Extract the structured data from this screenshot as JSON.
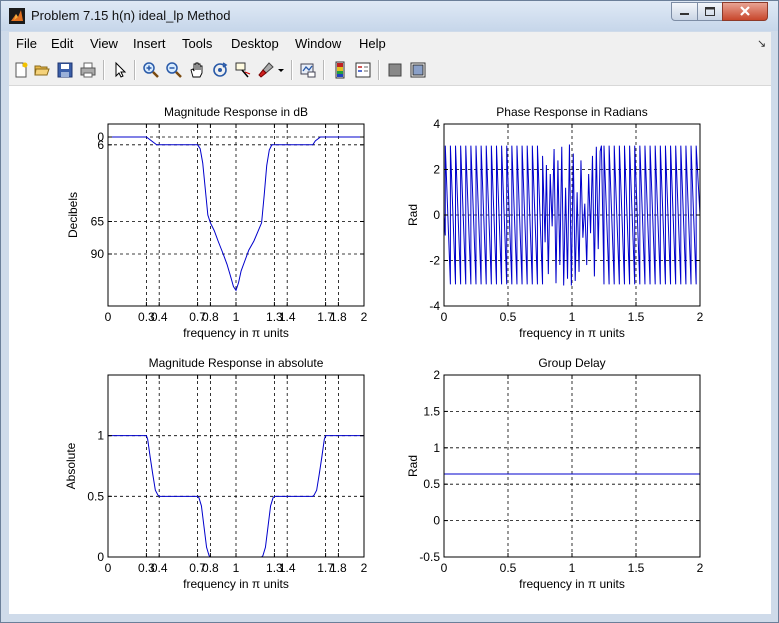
{
  "window": {
    "title": "Problem 7.15 h(n) ideal_lp Method"
  },
  "menubar": {
    "items": [
      "File",
      "Edit",
      "View",
      "Insert",
      "Tools",
      "Desktop",
      "Window",
      "Help"
    ]
  },
  "toolbar": {
    "icons": [
      "new-figure-icon",
      "open-file-icon",
      "save-icon",
      "print-icon",
      "edit-plot-icon",
      "zoom-in-icon",
      "zoom-out-icon",
      "pan-icon",
      "rotate-3d-icon",
      "data-cursor-icon",
      "brush-icon",
      "link-plot-icon",
      "colorbar-icon",
      "legend-icon",
      "hide-plot-tools-icon",
      "show-plot-tools-icon"
    ]
  },
  "colors": {
    "line": "#0000cc",
    "grid": "#000000",
    "figure_bg": "#ffffff"
  },
  "chart_data": [
    {
      "type": "line",
      "title": "Magnitude Response in dB",
      "xlabel": "frequency in π units",
      "ylabel": "Decibels",
      "xlim": [
        0,
        2
      ],
      "ylim": [
        -130,
        10
      ],
      "xticks": [
        0,
        0.3,
        0.4,
        0.7,
        0.8,
        1,
        1.3,
        1.4,
        1.7,
        1.8,
        2
      ],
      "xticklabels": [
        "0",
        "0.3",
        "0.4",
        "0.7",
        "0.8",
        "1",
        "1.3",
        "1.4",
        "1.7",
        "1.8",
        "2"
      ],
      "yticks": [
        0,
        -6,
        -65,
        -90
      ],
      "yticklabels": [
        "0",
        "6",
        "65",
        "90"
      ],
      "grid": true,
      "series": [
        {
          "x": [
            0,
            0.3,
            0.34,
            0.38,
            0.4,
            0.7,
            0.72,
            0.74,
            0.76,
            0.78,
            0.8,
            0.83,
            0.86,
            0.9,
            0.93,
            0.96,
            0.98,
            1.0,
            1.02,
            1.04,
            1.07,
            1.1,
            1.14,
            1.17,
            1.2,
            1.22,
            1.24,
            1.26,
            1.28,
            1.3,
            1.6,
            1.62,
            1.66,
            1.7,
            2.0
          ],
          "y": [
            0,
            0,
            -3,
            -6,
            -6,
            -6,
            -9,
            -20,
            -40,
            -60,
            -66,
            -72,
            -80,
            -90,
            -98,
            -108,
            -115,
            -118,
            -112,
            -103,
            -95,
            -87,
            -80,
            -73,
            -66,
            -45,
            -22,
            -10,
            -6,
            -6,
            -6,
            -3,
            0,
            0,
            0
          ]
        }
      ]
    },
    {
      "type": "line",
      "title": "Phase Response in Radians",
      "xlabel": "frequency in π units",
      "ylabel": "Rad",
      "xlim": [
        0,
        2
      ],
      "ylim": [
        -4,
        4
      ],
      "xticks": [
        0,
        0.5,
        1,
        1.5,
        2
      ],
      "xticklabels": [
        "0",
        "0.5",
        "1",
        "1.5",
        "2"
      ],
      "yticks": [
        -4,
        -2,
        0,
        2,
        4
      ],
      "yticklabels": [
        "-4",
        "-2",
        "0",
        "2",
        "4"
      ],
      "grid": true,
      "series": [
        {
          "x": [
            0,
            0.0099,
            0.01,
            0.0499,
            0.05,
            0.0899,
            0.09,
            0.1299,
            0.13,
            0.1699,
            0.17,
            0.2099,
            0.21,
            0.2499,
            0.25,
            0.2899,
            0.29,
            0.3299,
            0.33,
            0.3699,
            0.37,
            0.4099,
            0.41,
            0.4499,
            0.45,
            0.4899,
            0.49,
            0.5299,
            0.53,
            0.5699,
            0.57,
            0.6099,
            0.61,
            0.6499,
            0.65,
            0.6899,
            0.69,
            0.7299,
            0.73,
            0.7699,
            0.77,
            0.79,
            0.8,
            0.815,
            0.83,
            0.845,
            0.86,
            0.875,
            0.89,
            0.905,
            0.92,
            0.935,
            0.95,
            0.965,
            0.98,
            0.995,
            1.01,
            1.025,
            1.04,
            1.055,
            1.07,
            1.085,
            1.1,
            1.115,
            1.13,
            1.145,
            1.16,
            1.175,
            1.19,
            1.205,
            1.22,
            1.23,
            1.2499,
            1.25,
            1.2899,
            1.29,
            1.3299,
            1.33,
            1.3699,
            1.37,
            1.4099,
            1.41,
            1.4499,
            1.45,
            1.4899,
            1.49,
            1.5299,
            1.53,
            1.5699,
            1.57,
            1.6099,
            1.61,
            1.6499,
            1.65,
            1.6899,
            1.69,
            1.7299,
            1.73,
            1.7699,
            1.77,
            1.8099,
            1.81,
            1.8499,
            1.85,
            1.8899,
            1.89,
            1.9299,
            1.93,
            1.9699,
            1.97,
            2.0
          ],
          "y": [
            0,
            -0.9,
            3.05,
            -3.05,
            3.05,
            -3.05,
            3.05,
            -3.05,
            3.05,
            -3.05,
            3.05,
            -3.05,
            3.05,
            -3.05,
            3.05,
            -3.05,
            3.05,
            -3.05,
            3.05,
            -3.05,
            3.05,
            -3.05,
            3.05,
            -3.05,
            3.05,
            -3.05,
            3.05,
            -3.05,
            3.05,
            -3.05,
            3.05,
            -3.05,
            3.05,
            -3.05,
            3.05,
            -3.05,
            3.05,
            -3.05,
            3.05,
            -3.05,
            2.6,
            -1.2,
            2.2,
            -2.6,
            1.8,
            -0.5,
            2.9,
            -3.0,
            2.4,
            -2.2,
            3.0,
            -3.1,
            1.2,
            -2.8,
            3.1,
            -3.1,
            2.7,
            -2.9,
            1.0,
            -2.5,
            2.4,
            -1.0,
            0.5,
            -2.2,
            1.8,
            -0.8,
            2.6,
            -2.7,
            3.0,
            -1.5,
            2.8,
            3.05,
            -3.05,
            3.05,
            -3.05,
            3.05,
            -3.05,
            3.05,
            -3.05,
            3.05,
            -3.05,
            3.05,
            -3.05,
            3.05,
            -3.05,
            3.05,
            -3.05,
            3.05,
            -3.05,
            3.05,
            -3.05,
            3.05,
            -3.05,
            3.05,
            -3.05,
            3.05,
            -3.05,
            3.05,
            -3.05,
            3.05,
            -3.05,
            3.05,
            -3.05,
            3.05,
            -3.05,
            3.05,
            -3.05,
            3.05,
            -3.05,
            3.05,
            0.0
          ]
        }
      ]
    },
    {
      "type": "line",
      "title": "Magnitude Response in absolute",
      "xlabel": "frequency in π units",
      "ylabel": "Absolute",
      "xlim": [
        0,
        2
      ],
      "ylim": [
        0,
        1.5
      ],
      "xticks": [
        0,
        0.3,
        0.4,
        0.7,
        0.8,
        1,
        1.3,
        1.4,
        1.7,
        1.8,
        2
      ],
      "xticklabels": [
        "0",
        "0.3",
        "0.4",
        "0.7",
        "0.8",
        "1",
        "1.3",
        "1.4",
        "1.7",
        "1.8",
        "2"
      ],
      "yticks": [
        0,
        0.5,
        1
      ],
      "yticklabels": [
        "0",
        "0.5",
        "1"
      ],
      "grid": true,
      "series": [
        {
          "x": [
            0,
            0.3,
            0.31,
            0.33,
            0.35,
            0.37,
            0.39,
            0.4,
            0.7,
            0.71,
            0.73,
            0.75,
            0.77,
            0.79,
            0.8,
            1.2,
            1.21,
            1.23,
            1.25,
            1.27,
            1.29,
            1.3,
            1.6,
            1.61,
            1.63,
            1.65,
            1.67,
            1.69,
            1.7,
            2.0
          ],
          "y": [
            1,
            1,
            0.97,
            0.82,
            0.68,
            0.55,
            0.51,
            0.5,
            0.5,
            0.49,
            0.42,
            0.25,
            0.08,
            0.01,
            0,
            0,
            0.01,
            0.08,
            0.25,
            0.42,
            0.49,
            0.5,
            0.5,
            0.51,
            0.55,
            0.68,
            0.82,
            0.97,
            1,
            1
          ]
        }
      ]
    },
    {
      "type": "line",
      "title": "Group Delay",
      "xlabel": "frequency in π units",
      "ylabel": "Rad",
      "xlim": [
        0,
        2
      ],
      "ylim": [
        -0.5,
        2
      ],
      "xticks": [
        0,
        0.5,
        1,
        1.5,
        2
      ],
      "xticklabels": [
        "0",
        "0.5",
        "1",
        "1.5",
        "2"
      ],
      "yticks": [
        -0.5,
        0,
        0.5,
        1,
        1.5,
        2
      ],
      "yticklabels": [
        "-0.5",
        "0",
        "0.5",
        "1",
        "1.5",
        "2"
      ],
      "grid": true,
      "series": [
        {
          "x": [
            0,
            2
          ],
          "y": [
            0.64,
            0.64
          ]
        }
      ]
    }
  ]
}
